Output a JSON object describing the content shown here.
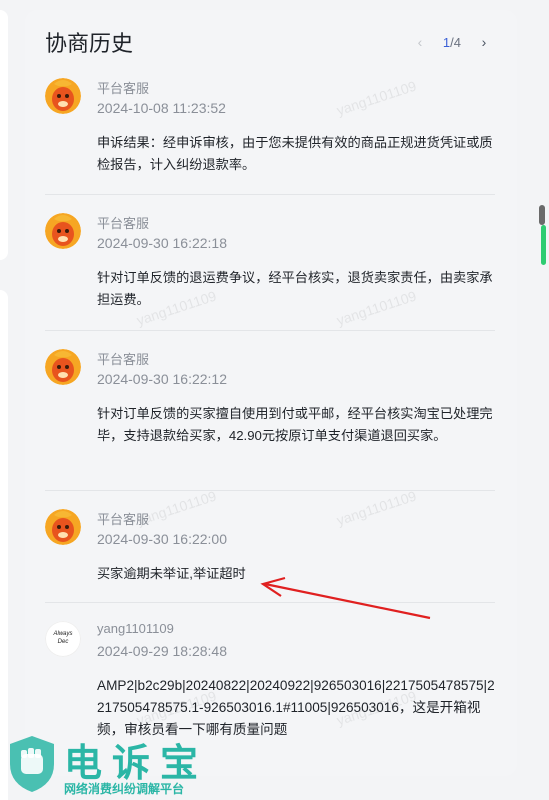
{
  "panel": {
    "title": "协商历史",
    "pager": {
      "prev_icon": "chevron-left-icon",
      "current": "1",
      "separator": "/",
      "total": "4",
      "next_icon": "chevron-right-icon"
    }
  },
  "entries": [
    {
      "name": "平台客服",
      "time": "2024-10-08 11:23:52",
      "message": "申诉结果：经申诉审核，由于您未提供有效的商品正规进货凭证或质检报告，计入纠纷退款率。",
      "avatar": "platform-mascot-icon"
    },
    {
      "name": "平台客服",
      "time": "2024-09-30 16:22:18",
      "message": "针对订单反馈的退运费争议，经平台核实，退货卖家责任，由卖家承担运费。",
      "avatar": "platform-mascot-icon"
    },
    {
      "name": "平台客服",
      "time": "2024-09-30 16:22:12",
      "message": "针对订单反馈的买家擅自使用到付或平邮，经平台核实淘宝已处理完毕，支持退款给买家，42.90元按原订单支付渠道退回买家。",
      "avatar": "platform-mascot-icon"
    },
    {
      "name": "平台客服",
      "time": "2024-09-30 16:22:00",
      "message": "买家逾期未举证,举证超时",
      "avatar": "platform-mascot-icon"
    },
    {
      "name": "yang1101109",
      "time": "2024-09-29 18:28:48",
      "message": "AMP2|b2c29b|20240822|20240922|926503016|2217505478575|2217505478575.1-926503016.1#11005|926503016，这是开箱视频，审核员看一下哪有质量问题",
      "avatar": "user-avatar-icon",
      "avatar_text": "Always Dec"
    }
  ],
  "watermark": "yang1101109",
  "logo": {
    "main": "电诉宝",
    "sub": "网络消费纠纷调解平台",
    "brand_color": "#2bb6a6"
  },
  "colors": {
    "annotation_arrow": "#e02020",
    "pager_active": "#3a5fd6"
  }
}
